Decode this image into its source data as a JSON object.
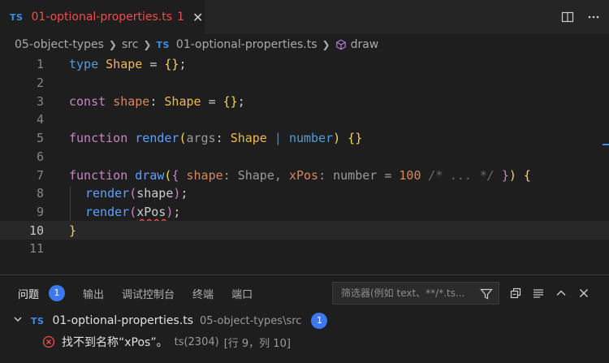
{
  "tab": {
    "badge": "TS",
    "title": "01-optional-properties.ts",
    "problem_count": "1",
    "close": "✕"
  },
  "breadcrumb": {
    "items": [
      "05-object-types",
      "src",
      "01-optional-properties.ts",
      "draw"
    ],
    "file_badge": "TS"
  },
  "editor": {
    "line_numbers": [
      "1",
      "2",
      "3",
      "4",
      "5",
      "6",
      "7",
      "8",
      "9",
      "10",
      "11"
    ],
    "active_line": "10",
    "lines": {
      "l1": {
        "kw": "type",
        "name": "Shape",
        "rest": " = ",
        "braces": "{}",
        "semi": ";"
      },
      "l3": {
        "kw": "const",
        "name": "shape",
        "colon": ": ",
        "type": "Shape",
        "rest": " = ",
        "braces": "{}",
        "semi": ";"
      },
      "l5": {
        "kw": "function",
        "fn": "render",
        "open": "(",
        "param": "args",
        "colon": ": ",
        "type": "Shape",
        "pipe": " | ",
        "num": "number",
        "close": ")",
        "braces": " {}"
      },
      "l7": {
        "kw": "function",
        "fn": "draw",
        "open": "(",
        "ob": "{ ",
        "p1": "shape",
        "c1": ": Shape, ",
        "p2": "xPos",
        "c2": ": number ",
        "eq": "= ",
        "val": "100",
        "comment": " /* ... */ ",
        "cb": "}",
        "close": ")",
        "brace": " {"
      },
      "l8": {
        "fn": "render",
        "open": "(",
        "arg": "shape",
        "close": ")",
        "semi": ";"
      },
      "l9": {
        "fn": "render",
        "open": "(",
        "arg": "xPos",
        "close": ")",
        "semi": ";"
      },
      "l10": {
        "brace": "}"
      }
    }
  },
  "panel": {
    "tabs": [
      {
        "label": "问题",
        "badge": "1"
      },
      {
        "label": "输出"
      },
      {
        "label": "调试控制台"
      },
      {
        "label": "终端"
      },
      {
        "label": "端口"
      }
    ],
    "filter_placeholder": "筛选器(例如 text、**/*.ts...",
    "problem_file": {
      "badge": "TS",
      "name": "01-optional-properties.ts",
      "path": "05-object-types\\src",
      "count": "1"
    },
    "problem": {
      "message": "找不到名称“xPos”。",
      "source": "ts(2304)",
      "location": "[行 9，列 10]"
    }
  },
  "colors": {
    "accent": "#3e77f2",
    "error": "#f14c4c",
    "ts": "#3b8eea"
  }
}
